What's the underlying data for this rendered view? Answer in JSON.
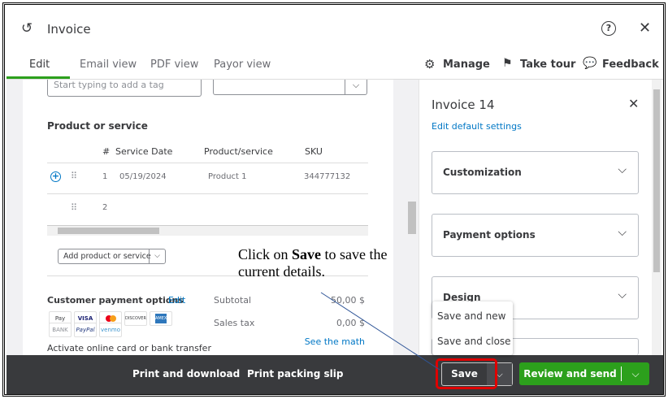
{
  "header": {
    "title": "Invoice"
  },
  "tabs": [
    {
      "label": "Edit"
    },
    {
      "label": "Email view"
    },
    {
      "label": "PDF view"
    },
    {
      "label": "Payor view"
    }
  ],
  "toolbar": {
    "manage": "Manage",
    "take_tour": "Take tour",
    "feedback": "Feedback"
  },
  "form": {
    "tag_placeholder": "Start typing to add a tag",
    "section_title": "Product or service",
    "columns": [
      "#",
      "Service Date",
      "Product/service",
      "SKU"
    ],
    "rows": [
      {
        "num": "1",
        "date": "05/19/2024",
        "product": "Product 1",
        "sku": "344777132"
      },
      {
        "num": "2",
        "date": "",
        "product": "",
        "sku": ""
      }
    ],
    "add_product": "Add product or service",
    "payment_title": "Customer payment options",
    "payment_edit": "Edit",
    "payment_methods": [
      "Pay",
      "VISA",
      "",
      "DISCOVER",
      "AMEX",
      "BANK",
      "PayPal",
      "venmo"
    ],
    "activate": "Activate online card or bank transfer",
    "subtotal_label": "Subtotal",
    "subtotal_value": "50,00 $",
    "tax_label": "Sales tax",
    "tax_value": "0,00 $",
    "see_math": "See the math"
  },
  "panel": {
    "title": "Invoice 14",
    "edit_defaults": "Edit default settings",
    "sections": [
      "Customization",
      "Payment options",
      "Design"
    ]
  },
  "bottom": {
    "print_download": "Print and download",
    "packing_slip": "Print packing slip",
    "save": "Save",
    "review_send": "Review and send"
  },
  "save_menu": [
    "Save and new",
    "Save and close"
  ],
  "annotation": {
    "pre": "Click on ",
    "bold": "Save",
    "post": " to save the current details."
  },
  "colors": {
    "accent": "#2ca01c",
    "link": "#0077c5",
    "bar": "#393a3d",
    "highlight": "#e00000"
  }
}
